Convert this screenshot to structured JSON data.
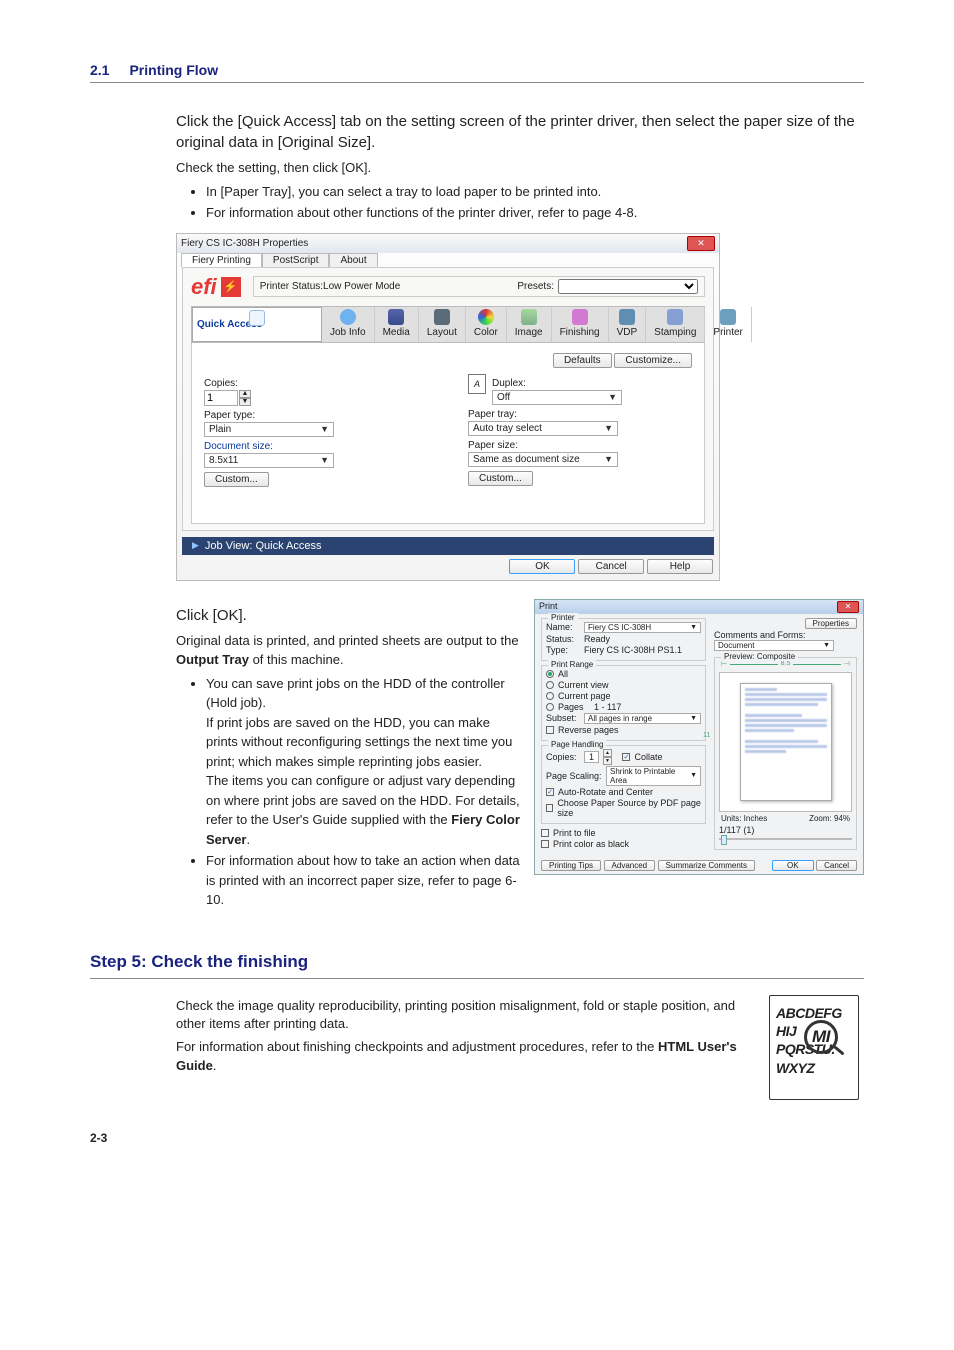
{
  "header": {
    "num": "2.1",
    "title": "Printing Flow"
  },
  "intro": {
    "p1": "Click the [Quick Access] tab on the setting screen of the printer driver, then select the paper size of the original data in [Original Size].",
    "p2": "Check the setting, then click [OK].",
    "bullets": [
      "In [Paper Tray], you can select a tray to load paper to be printed into.",
      "For information about other functions of the printer driver, refer to page 4-8."
    ]
  },
  "driver": {
    "title": "Fiery CS IC-308H Properties",
    "top_tabs": [
      "Fiery Printing",
      "PostScript",
      "About"
    ],
    "brand": "efi",
    "status": "Printer Status:Low Power Mode",
    "presets_label": "Presets:",
    "cats": [
      "Quick Access",
      "Job Info",
      "Media",
      "Layout",
      "Color",
      "Image",
      "Finishing",
      "VDP",
      "Stamping",
      "Printer"
    ],
    "cat_colors": [
      "#eef5ff",
      "#6fb2f0",
      "#5566aa",
      "#5a6b7a",
      "#e9c055",
      "#7eb08a",
      "#d27ad2",
      "#5e8fb0",
      "#86a0d6",
      "#6da0c0"
    ],
    "buttons_top": {
      "defaults": "Defaults",
      "customize": "Customize..."
    },
    "left": {
      "copies_label": "Copies:",
      "copies_value": "1",
      "ptype_label": "Paper type:",
      "ptype_value": "Plain",
      "dsize_label": "Document size:",
      "dsize_value": "8.5x11",
      "custom": "Custom..."
    },
    "right": {
      "duplex_label": "Duplex:",
      "duplex_value": "Off",
      "ptray_label": "Paper tray:",
      "ptray_value": "Auto tray select",
      "psize_label": "Paper size:",
      "psize_value": "Same as document size",
      "custom": "Custom..."
    },
    "jobview": "Job View: Quick Access",
    "bottom": {
      "ok": "OK",
      "cancel": "Cancel",
      "help": "Help"
    }
  },
  "middle": {
    "p1": "Click [OK].",
    "p2a": "Original data is printed, and printed sheets are output to the ",
    "p2b": "Output Tray",
    "p2c": " of this machine.",
    "bullets": [
      "You can save print jobs on the HDD of the controller (Hold job).\nIf print jobs are saved on the HDD, you can make prints without reconfiguring settings the next time you print; which makes simple reprinting jobs easier.\nThe items you can configure or adjust vary depending on where print jobs are saved on the HDD. For details, refer to the User's Guide supplied with the Fiery Color Server.",
      "For information about how to take an action when data is printed with an incorrect paper size, refer to page 6-10."
    ],
    "bullet1_bold": "Fiery Color Server"
  },
  "print_dialog": {
    "title": "Print",
    "printer": {
      "legend": "Printer",
      "name_l": "Name:",
      "name_v": "Fiery CS IC-308H",
      "status_l": "Status:",
      "status_v": "Ready",
      "type_l": "Type:",
      "type_v": "Fiery CS IC-308H PS1.1",
      "prop": "Properties",
      "comments_l": "Comments and Forms:",
      "comments_v": "Document"
    },
    "range": {
      "legend": "Print Range",
      "all": "All",
      "cv": "Current view",
      "cp": "Current page",
      "pages_l": "Pages",
      "pages_v": "1 - 117",
      "subset_l": "Subset:",
      "subset_v": "All pages in range",
      "reverse": "Reverse pages"
    },
    "handling": {
      "legend": "Page Handling",
      "copies_l": "Copies:",
      "copies_v": "1",
      "collate": "Collate",
      "scale_l": "Page Scaling:",
      "scale_v": "Shrink to Printable Area",
      "auto": "Auto-Rotate and Center",
      "bypdf": "Choose Paper Source by PDF page size"
    },
    "opts": {
      "ptf": "Print to file",
      "pcab": "Print color as black"
    },
    "preview": {
      "legend": "Preview: Composite",
      "width": "8.5",
      "height": "11",
      "units": "Units: Inches",
      "zoom": "Zoom: 94%",
      "sheet": "1/117 (1)"
    },
    "bottom": {
      "tips": "Printing Tips",
      "adv": "Advanced",
      "sum": "Summarize Comments",
      "ok": "OK",
      "cancel": "Cancel"
    }
  },
  "step5": {
    "heading": "Step 5: Check the finishing",
    "p1": "Check the image quality reproducibility, printing position misalignment, fold or staple position, and other items after printing data.",
    "p2a": "For information about finishing checkpoints and adjustment procedures, refer to the ",
    "p2b": "HTML User's Guide",
    "p2c": ".",
    "fig": {
      "l1": "ABCDEFG",
      "l2a": "HIJ",
      "l2b": "MI",
      "l3": "PQRSTU.",
      "l4": "WXYZ"
    }
  },
  "pagenum": "2-3"
}
